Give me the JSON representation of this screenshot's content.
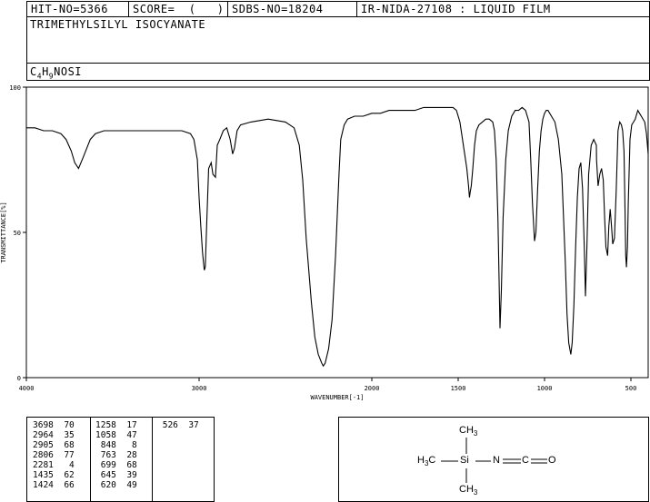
{
  "header": {
    "hit_no": "HIT-NO=5366",
    "score": "SCORE=  (   )",
    "sdbs_no": "SDBS-NO=18204",
    "ir_info": "IR-NIDA-27108 : LIQUID FILM",
    "compound_name": "TRIMETHYLSILYL ISOCYANATE",
    "formula_parts": [
      "C",
      "4",
      "H",
      "9",
      "NOSI"
    ]
  },
  "chart_data": {
    "type": "line",
    "xlabel": "WAVENUMBER[-1]",
    "ylabel": "TRANSMITTANCE[%]",
    "xlim": [
      4000,
      400
    ],
    "ylim": [
      0,
      100
    ],
    "xticks": [
      "4000",
      "3000",
      "2000",
      "1500",
      "1000",
      "500"
    ],
    "yticks": [
      "100",
      "50",
      "0"
    ],
    "x": [
      4000,
      3950,
      3900,
      3850,
      3800,
      3770,
      3740,
      3720,
      3698,
      3670,
      3630,
      3600,
      3550,
      3500,
      3450,
      3400,
      3300,
      3200,
      3100,
      3050,
      3030,
      3010,
      3000,
      2990,
      2980,
      2970,
      2964,
      2955,
      2945,
      2930,
      2920,
      2905,
      2895,
      2880,
      2860,
      2840,
      2820,
      2806,
      2795,
      2780,
      2760,
      2700,
      2600,
      2500,
      2450,
      2420,
      2400,
      2380,
      2350,
      2330,
      2310,
      2290,
      2281,
      2270,
      2250,
      2230,
      2210,
      2190,
      2180,
      2160,
      2140,
      2100,
      2050,
      2000,
      1950,
      1900,
      1850,
      1800,
      1750,
      1700,
      1650,
      1600,
      1560,
      1530,
      1510,
      1490,
      1470,
      1450,
      1440,
      1435,
      1430,
      1424,
      1415,
      1405,
      1395,
      1380,
      1360,
      1340,
      1320,
      1300,
      1290,
      1280,
      1270,
      1258,
      1250,
      1240,
      1225,
      1210,
      1190,
      1170,
      1150,
      1130,
      1110,
      1090,
      1080,
      1070,
      1058,
      1050,
      1040,
      1030,
      1020,
      1010,
      1000,
      990,
      980,
      970,
      960,
      940,
      920,
      900,
      890,
      880,
      870,
      860,
      848,
      840,
      830,
      820,
      810,
      800,
      790,
      780,
      770,
      763,
      755,
      745,
      730,
      715,
      700,
      699,
      690,
      680,
      670,
      660,
      652,
      645,
      635,
      628,
      620,
      612,
      605,
      595,
      585,
      575,
      565,
      555,
      548,
      540,
      535,
      530,
      526,
      520,
      515,
      505,
      495,
      485,
      475,
      470,
      460,
      450,
      440,
      420,
      410,
      400
    ],
    "y": [
      86,
      86,
      85,
      85,
      84,
      82,
      78,
      74,
      72,
      76,
      82,
      84,
      85,
      85,
      85,
      85,
      85,
      85,
      85,
      84,
      82,
      75,
      62,
      52,
      43,
      37,
      38,
      55,
      72,
      74,
      70,
      69,
      80,
      82,
      85,
      86,
      82,
      77,
      79,
      85,
      87,
      88,
      89,
      88,
      86,
      80,
      68,
      48,
      26,
      14,
      8,
      5,
      4,
      5,
      10,
      20,
      42,
      70,
      82,
      87,
      89,
      90,
      90,
      91,
      91,
      92,
      92,
      92,
      92,
      93,
      93,
      93,
      93,
      93,
      92,
      88,
      80,
      72,
      66,
      62,
      64,
      66,
      72,
      80,
      85,
      87,
      88,
      89,
      89,
      88,
      85,
      75,
      55,
      17,
      30,
      55,
      75,
      85,
      90,
      92,
      92,
      93,
      92,
      88,
      75,
      60,
      47,
      50,
      65,
      78,
      85,
      89,
      91,
      92,
      92,
      91,
      90,
      88,
      82,
      70,
      55,
      40,
      22,
      12,
      8,
      12,
      25,
      45,
      62,
      72,
      74,
      65,
      45,
      28,
      45,
      70,
      80,
      82,
      80,
      75,
      66,
      70,
      72,
      68,
      55,
      45,
      42,
      52,
      58,
      52,
      46,
      48,
      65,
      85,
      88,
      87,
      85,
      78,
      60,
      42,
      38,
      45,
      60,
      82,
      87,
      88,
      89,
      90,
      92,
      91,
      90,
      88,
      84,
      77
    ]
  },
  "peaks": {
    "col1": "3698  70\n2964  35\n2905  68\n2806  77\n2281   4\n1435  62\n1424  66",
    "col2": "1258  17\n1058  47\n 848   8\n 763  28\n 699  68\n 645  39\n 620  49",
    "col3": " 526  37"
  },
  "structure": {
    "top_methyl": [
      "CH",
      "3"
    ],
    "left_methyl": [
      "H",
      "3",
      "C"
    ],
    "bottom_methyl": [
      "CH",
      "3"
    ],
    "si": "Si",
    "n": "N",
    "c": "C",
    "o": "O"
  }
}
